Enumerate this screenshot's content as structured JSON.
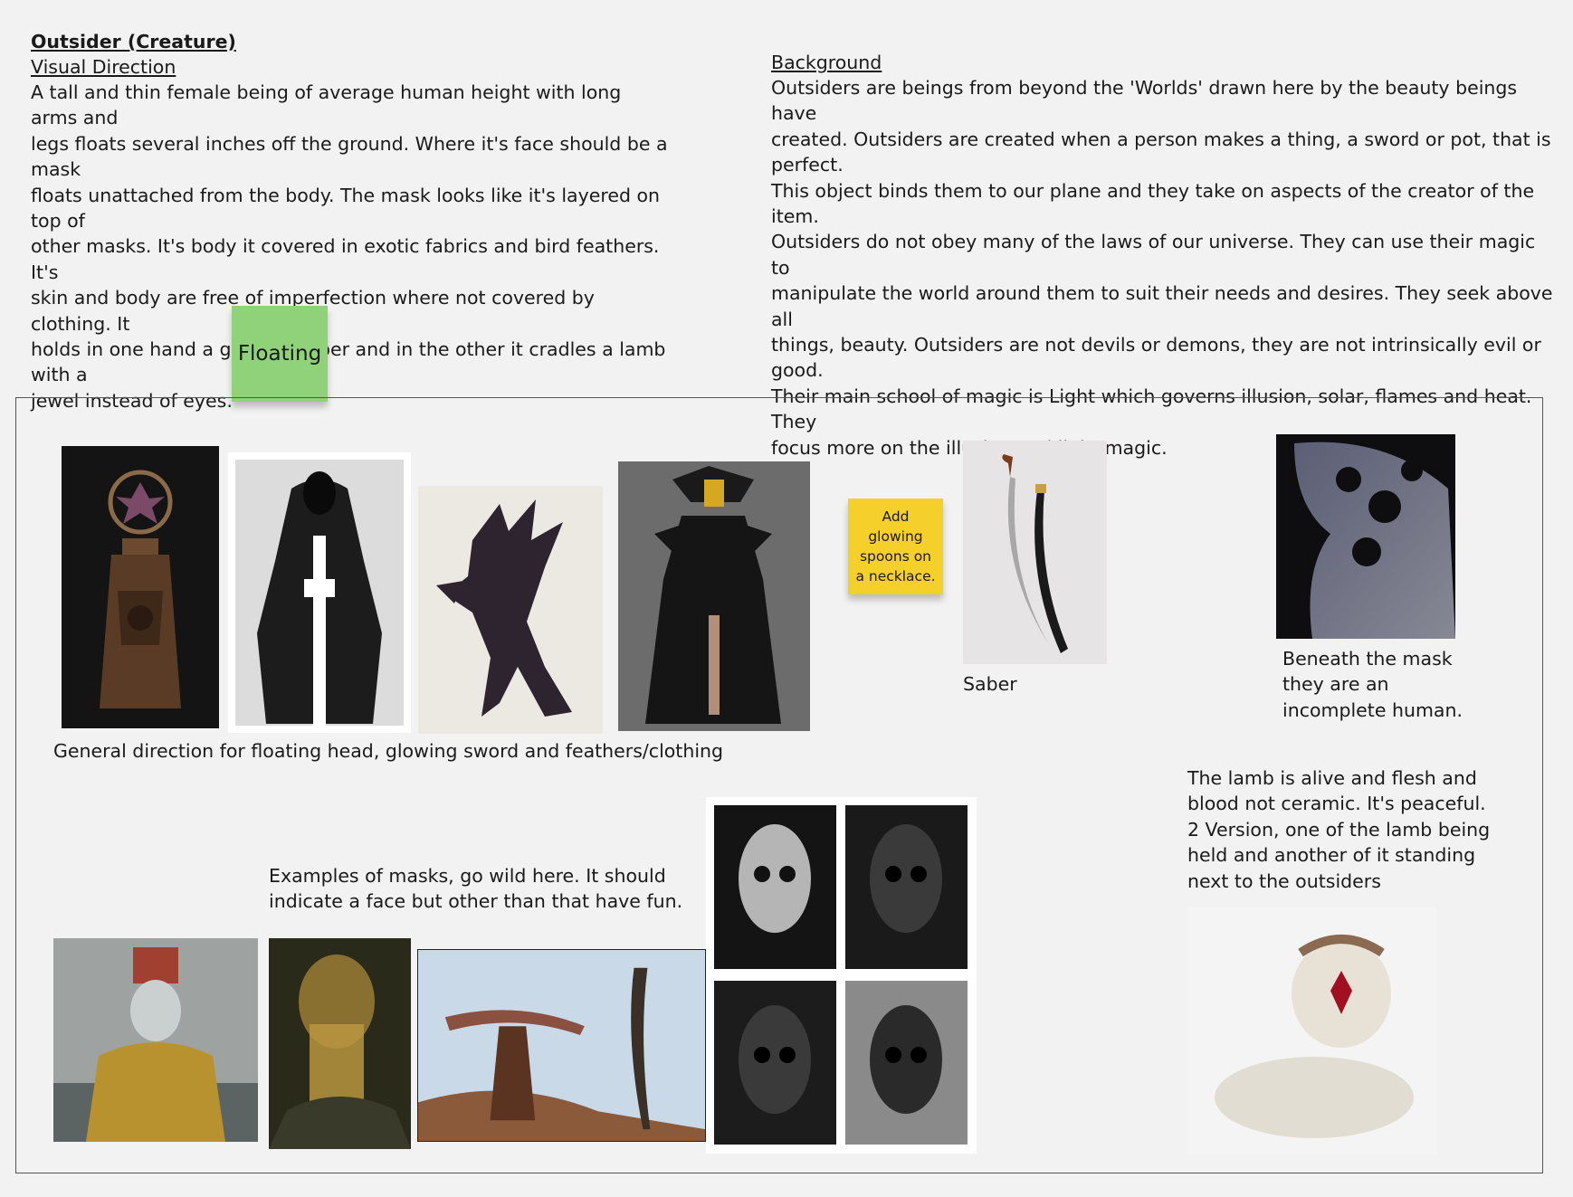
{
  "title": "Outsider (Creature)",
  "visual_direction": {
    "heading": "Visual Direction",
    "body": "A tall and thin female being of average human height with long arms and\nlegs floats several inches off the ground.  Where it's face should be a mask\nfloats unattached from the body.  The mask looks like it's layered on top of\nother masks.  It's body it covered in exotic fabrics and bird feathers.  It's\nskin and body are free of imperfection where not covered by clothing.  It\nholds in one hand a glowing saber and in the other it cradles a lamb with a\njewel instead of eyes."
  },
  "background": {
    "heading": "Background",
    "body": "Outsiders are beings from beyond the 'Worlds' drawn here by the beauty beings have\ncreated. Outsiders are created when a person makes a thing, a sword or pot, that is perfect.\n This object binds them to our plane and they take on aspects of the creator of the item.\nOutsiders do not obey many of the laws of our universe.  They can use their magic to\nmanipulate the world around them to suit their needs and desires.  They seek above all\nthings, beauty.  Outsiders are not devils or demons, they are not intrinsically evil or good.\nTheir main school of magic is Light which governs illusion, solar, flames and heat.  They\nfocus more on the illusion and light magic."
  },
  "stickies": {
    "floating": "Floating",
    "spoons": "Add\nglowing\nspoons on\na necklace."
  },
  "captions": {
    "general": "General direction for floating head, glowing sword and feathers/clothing",
    "saber": "Saber",
    "beneath": "Beneath the mask\nthey are an\nincomplete human.",
    "lamb": "The lamb is alive and flesh and\nblood not ceramic.  It's peaceful.\n2 Version, one of the lamb being\nheld and another of it standing\nnext to the outsiders",
    "masks": "Examples of masks, go wild here.  It should\nindicate a face but other than that have fun."
  },
  "colors": {
    "sticky_green": "#8fd27a",
    "sticky_yellow": "#f5cf2a",
    "canvas": "#f2f2f2"
  }
}
